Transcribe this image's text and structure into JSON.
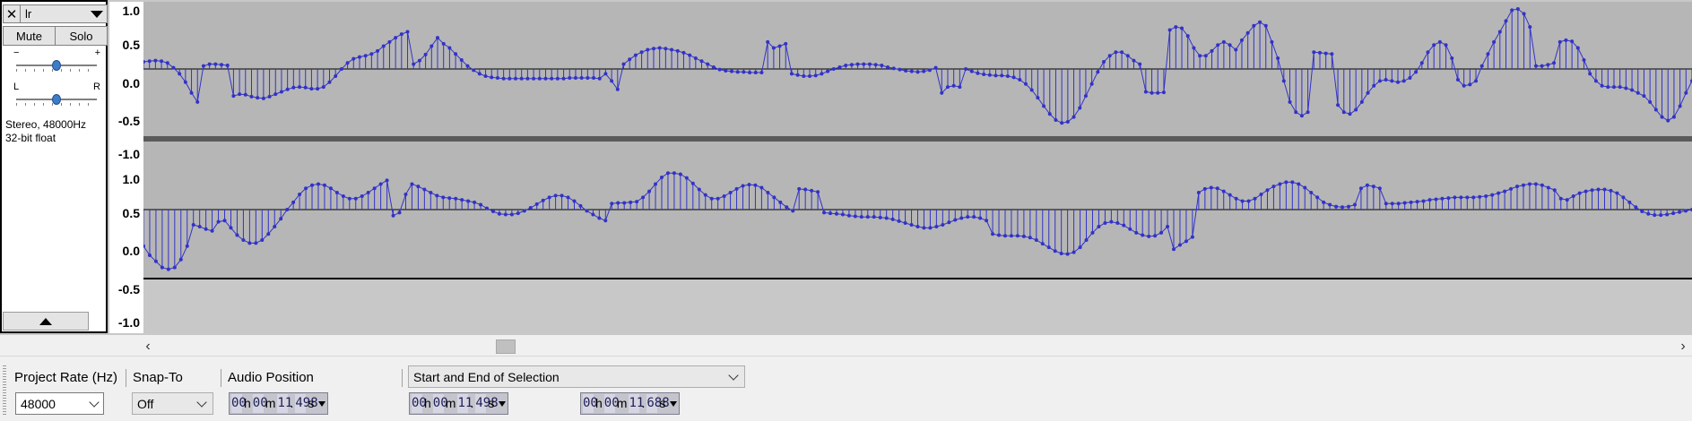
{
  "track": {
    "close_symbol": "✕",
    "name": "lr",
    "mute_label": "Mute",
    "solo_label": "Solo",
    "gain_min": "−",
    "gain_max": "+",
    "pan_left": "L",
    "pan_right": "R",
    "info_line1": "Stereo, 48000Hz",
    "info_line2": "32-bit float"
  },
  "ruler": {
    "top_channel": [
      "1.0",
      "0.5",
      "0.0",
      "-0.5",
      "-1.0"
    ],
    "bottom_channel": [
      "1.0",
      "0.5",
      "0.0",
      "-0.5",
      "-1.0"
    ]
  },
  "waveform": {
    "color": "#3232c8",
    "background": "#b6b6b6",
    "top_channel_samples": [
      0.12,
      0.13,
      0.14,
      0.13,
      0.1,
      0.02,
      -0.08,
      -0.22,
      -0.4,
      -0.55,
      0.05,
      0.08,
      0.08,
      0.07,
      0.06,
      -0.45,
      -0.42,
      -0.43,
      -0.46,
      -0.48,
      -0.49,
      -0.46,
      -0.42,
      -0.38,
      -0.34,
      -0.31,
      -0.3,
      -0.31,
      -0.33,
      -0.33,
      -0.3,
      -0.22,
      -0.12,
      0.0,
      0.1,
      0.17,
      0.2,
      0.22,
      0.25,
      0.3,
      0.38,
      0.45,
      0.52,
      0.58,
      0.62,
      0.08,
      0.14,
      0.24,
      0.38,
      0.52,
      0.42,
      0.35,
      0.25,
      0.15,
      0.05,
      -0.02,
      -0.08,
      -0.12,
      -0.14,
      -0.15,
      -0.16,
      -0.16,
      -0.16,
      -0.16,
      -0.16,
      -0.16,
      -0.16,
      -0.16,
      -0.16,
      -0.16,
      -0.16,
      -0.15,
      -0.15,
      -0.15,
      -0.15,
      -0.15,
      -0.16,
      -0.08,
      -0.2,
      -0.34,
      0.08,
      0.16,
      0.23,
      0.28,
      0.32,
      0.34,
      0.35,
      0.34,
      0.32,
      0.3,
      0.27,
      0.23,
      0.18,
      0.13,
      0.08,
      0.03,
      -0.01,
      -0.03,
      -0.04,
      -0.05,
      -0.05,
      -0.06,
      -0.06,
      -0.06,
      0.45,
      0.35,
      0.38,
      0.42,
      -0.08,
      -0.1,
      -0.12,
      -0.12,
      -0.11,
      -0.08,
      -0.04,
      0.0,
      0.03,
      0.06,
      0.07,
      0.08,
      0.08,
      0.08,
      0.07,
      0.06,
      0.03,
      0.01,
      -0.01,
      -0.03,
      -0.04,
      -0.05,
      -0.04,
      -0.02,
      0.02,
      -0.4,
      -0.3,
      -0.28,
      -0.3,
      0.0,
      -0.04,
      -0.07,
      -0.09,
      -0.1,
      -0.11,
      -0.11,
      -0.12,
      -0.14,
      -0.18,
      -0.25,
      -0.35,
      -0.48,
      -0.62,
      -0.75,
      -0.85,
      -0.9,
      -0.88,
      -0.8,
      -0.65,
      -0.45,
      -0.25,
      -0.05,
      0.12,
      0.22,
      0.28,
      0.28,
      0.22,
      0.14,
      0.08,
      -0.38,
      -0.4,
      -0.4,
      -0.39,
      0.65,
      0.7,
      0.68,
      0.55,
      0.35,
      0.22,
      0.22,
      0.3,
      0.4,
      0.45,
      0.4,
      0.32,
      0.48,
      0.6,
      0.72,
      0.78,
      0.72,
      0.45,
      0.18,
      -0.2,
      -0.55,
      -0.72,
      -0.78,
      -0.72,
      0.28,
      0.27,
      0.26,
      0.25,
      -0.6,
      -0.72,
      -0.75,
      -0.68,
      -0.55,
      -0.4,
      -0.28,
      -0.2,
      -0.18,
      -0.2,
      -0.22,
      -0.2,
      -0.15,
      -0.05,
      0.1,
      0.28,
      0.4,
      0.45,
      0.4,
      0.18,
      -0.18,
      -0.28,
      -0.26,
      -0.2,
      0.05,
      0.25,
      0.45,
      0.62,
      0.8,
      0.98,
      1.0,
      0.92,
      0.7,
      0.05,
      0.05,
      0.07,
      0.1,
      0.45,
      0.48,
      0.46,
      0.35,
      0.15,
      -0.08,
      -0.2,
      -0.28,
      -0.3,
      -0.3,
      -0.3,
      -0.32,
      -0.35,
      -0.4,
      -0.45,
      -0.55,
      -0.68,
      -0.8,
      -0.86,
      -0.8,
      -0.62,
      -0.4,
      -0.2
    ],
    "bottom_channel_samples": [
      -0.6,
      -0.75,
      -0.85,
      -0.95,
      -0.98,
      -0.95,
      -0.82,
      -0.6,
      -0.25,
      -0.28,
      -0.32,
      -0.35,
      -0.2,
      -0.18,
      -0.3,
      -0.42,
      -0.5,
      -0.55,
      -0.55,
      -0.5,
      -0.4,
      -0.28,
      -0.15,
      0.0,
      0.12,
      0.25,
      0.35,
      0.4,
      0.42,
      0.4,
      0.35,
      0.28,
      0.22,
      0.18,
      0.18,
      0.22,
      0.28,
      0.35,
      0.42,
      0.48,
      -0.1,
      -0.05,
      0.25,
      0.42,
      0.38,
      0.33,
      0.28,
      0.23,
      0.2,
      0.19,
      0.18,
      0.16,
      0.14,
      0.12,
      0.08,
      0.02,
      -0.03,
      -0.07,
      -0.08,
      -0.08,
      -0.06,
      -0.02,
      0.03,
      0.09,
      0.15,
      0.2,
      0.23,
      0.23,
      0.2,
      0.14,
      0.06,
      -0.02,
      -0.08,
      -0.14,
      -0.18,
      0.1,
      0.11,
      0.11,
      0.12,
      0.13,
      0.2,
      0.3,
      0.42,
      0.53,
      0.6,
      0.6,
      0.58,
      0.52,
      0.43,
      0.33,
      0.24,
      0.18,
      0.18,
      0.22,
      0.28,
      0.34,
      0.39,
      0.41,
      0.4,
      0.36,
      0.28,
      0.2,
      0.12,
      0.04,
      -0.02,
      0.34,
      0.33,
      0.31,
      0.29,
      -0.05,
      -0.06,
      -0.07,
      -0.08,
      -0.1,
      -0.11,
      -0.12,
      -0.12,
      -0.12,
      -0.13,
      -0.14,
      -0.16,
      -0.19,
      -0.22,
      -0.25,
      -0.28,
      -0.3,
      -0.3,
      -0.28,
      -0.25,
      -0.21,
      -0.17,
      -0.14,
      -0.12,
      -0.12,
      -0.14,
      -0.18,
      -0.4,
      -0.42,
      -0.43,
      -0.43,
      -0.43,
      -0.44,
      -0.46,
      -0.5,
      -0.56,
      -0.62,
      -0.68,
      -0.72,
      -0.73,
      -0.7,
      -0.62,
      -0.5,
      -0.38,
      -0.28,
      -0.22,
      -0.2,
      -0.22,
      -0.26,
      -0.32,
      -0.38,
      -0.42,
      -0.44,
      -0.43,
      -0.38,
      -0.28,
      -0.65,
      -0.58,
      -0.52,
      -0.45,
      0.28,
      0.34,
      0.36,
      0.35,
      0.3,
      0.24,
      0.18,
      0.14,
      0.14,
      0.18,
      0.25,
      0.32,
      0.38,
      0.42,
      0.45,
      0.45,
      0.42,
      0.36,
      0.28,
      0.2,
      0.12,
      0.08,
      0.05,
      0.04,
      0.05,
      0.08,
      0.35,
      0.4,
      0.38,
      0.35,
      0.1,
      0.1,
      0.1,
      0.11,
      0.12,
      0.13,
      0.14,
      0.16,
      0.17,
      0.18,
      0.19,
      0.2,
      0.2,
      0.2,
      0.2,
      0.21,
      0.22,
      0.24,
      0.27,
      0.3,
      0.34,
      0.38,
      0.4,
      0.42,
      0.42,
      0.4,
      0.36,
      0.32,
      0.18,
      0.16,
      0.22,
      0.27,
      0.3,
      0.32,
      0.33,
      0.33,
      0.31,
      0.27,
      0.2,
      0.12,
      0.04,
      -0.03,
      -0.07,
      -0.09,
      -0.09,
      -0.08,
      -0.06,
      -0.04,
      -0.02,
      0.0
    ]
  },
  "scrollbar": {
    "left_arrow": "‹",
    "right_arrow": "›"
  },
  "toolbar": {
    "project_rate_label": "Project Rate (Hz)",
    "project_rate_value": "48000",
    "snap_to_label": "Snap-To",
    "snap_to_value": "Off",
    "audio_position_label": "Audio Position",
    "selection_mode_value": "Start and End of Selection",
    "audio_position": {
      "h": "00",
      "m": "00",
      "s_int": "11",
      "s_frac": "498"
    },
    "selection_start": {
      "h": "00",
      "m": "00",
      "s_int": "11",
      "s_frac": "498"
    },
    "selection_end": {
      "h": "00",
      "m": "00",
      "s_int": "11",
      "s_frac": "688"
    },
    "units": {
      "h": "h",
      "m": "m",
      "s": "s"
    }
  }
}
